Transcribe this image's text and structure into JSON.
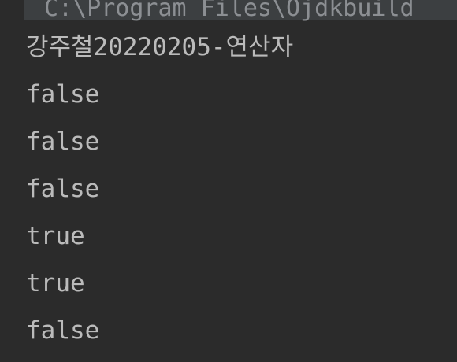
{
  "console": {
    "command": "C:\\Program Files\\Ojdkbuild",
    "output": [
      "강주철20220205-연산자",
      "false",
      "false",
      "false",
      "true",
      "true",
      "false"
    ]
  }
}
